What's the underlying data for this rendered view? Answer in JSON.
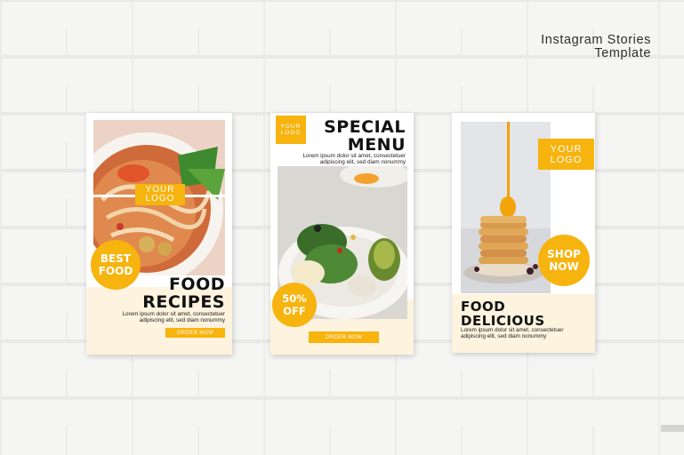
{
  "header": {
    "line1": "Instagram Stories",
    "line2": "Template"
  },
  "colors": {
    "accent": "#f7b30e",
    "cream": "#fdf3de",
    "background": "#f5f5f4"
  },
  "cards": [
    {
      "logo_line1": "YOUR",
      "logo_line2": "LOGO",
      "badge_line1": "BEST",
      "badge_line2": "FOOD",
      "title_line1": "FOOD",
      "title_line2": "RECIPES",
      "body_line1": "Lorem ipsum dolor sit amet, consectetuer",
      "body_line2": "adipiscing elit, sed diam nonummy",
      "button": "ORDER NOW",
      "image": "noodle-soup-photo"
    },
    {
      "logo_line1": "YOUR",
      "logo_line2": "LOGO",
      "title_line1": "SPECIAL",
      "title_line2": "MENU",
      "body_line1": "Lorem ipsum dolor sit amet, consectetuer",
      "body_line2": "adipiscing elit, sed diam nonummy",
      "badge_line1": "50%",
      "badge_line2": "OFF",
      "button": "ORDER NOW",
      "image": "salad-plate-photo"
    },
    {
      "logo_line1": "YOUR",
      "logo_line2": "LOGO",
      "badge_line1": "SHOP",
      "badge_line2": "NOW",
      "title_line1": "FOOD",
      "title_line2": "DELICIOUS",
      "body_line1": "Lorem ipsum dolor sit amet, consectetuer",
      "body_line2": "adipiscing elit, sed diam nonummy",
      "image": "pancake-stack-photo"
    }
  ]
}
